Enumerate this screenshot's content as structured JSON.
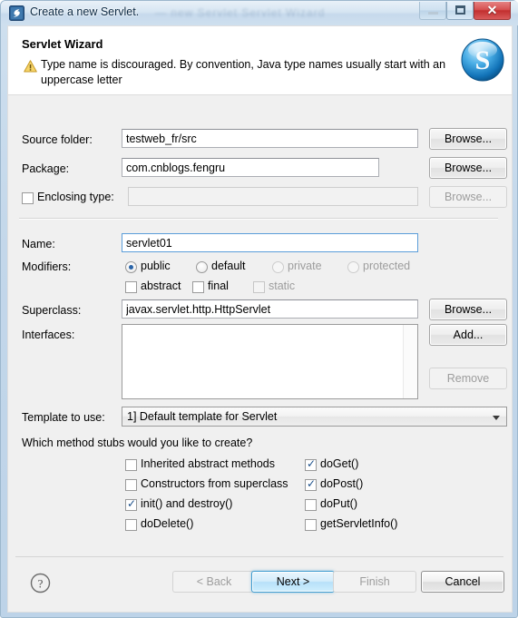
{
  "window": {
    "title": "Create a new Servlet.",
    "title_ghost": "— new Servlet   Servlet   Wizard",
    "icon": "eclipse-servlet-icon",
    "controls": {
      "minimize": "minimize-button",
      "maximize": "restore-button",
      "close": "close-button",
      "close_glyph": "✕"
    }
  },
  "banner": {
    "title": "Servlet Wizard",
    "message": "Type name is discouraged. By convention, Java type names usually start with an uppercase letter",
    "warning_icon": "warning-triangle-icon",
    "logo": "servlet-wizard-logo",
    "logo_letter": "S"
  },
  "fields": {
    "source_folder": {
      "label": "Source folder:",
      "value": "testweb_fr/src",
      "browse": "Browse..."
    },
    "package": {
      "label": "Package:",
      "value": "com.cnblogs.fengru",
      "browse": "Browse..."
    },
    "enclosing_type": {
      "label": "Enclosing type:",
      "value": "",
      "checked": false,
      "browse": "Browse...",
      "browse_enabled": false
    },
    "name": {
      "label": "Name:",
      "value": "servlet01"
    },
    "superclass": {
      "label": "Superclass:",
      "value": "javax.servlet.http.HttpServlet",
      "browse": "Browse..."
    },
    "interfaces": {
      "label": "Interfaces:",
      "items": [],
      "add": "Add...",
      "remove": "Remove",
      "remove_enabled": false
    },
    "template": {
      "label": "Template to use:",
      "selected": "1] Default template for Servlet",
      "options": [
        "1] Default template for Servlet"
      ]
    }
  },
  "modifiers": {
    "label": "Modifiers:",
    "access": [
      {
        "label": "public",
        "selected": true,
        "enabled": true
      },
      {
        "label": "default",
        "selected": false,
        "enabled": true
      },
      {
        "label": "private",
        "selected": false,
        "enabled": false
      },
      {
        "label": "protected",
        "selected": false,
        "enabled": false
      }
    ],
    "flags": [
      {
        "label": "abstract",
        "checked": false,
        "enabled": true
      },
      {
        "label": "final",
        "checked": false,
        "enabled": true
      },
      {
        "label": "static",
        "checked": false,
        "enabled": false
      }
    ]
  },
  "stubs": {
    "question": "Which method stubs would you like to create?",
    "left": [
      {
        "label": "Inherited abstract methods",
        "checked": false
      },
      {
        "label": "Constructors from superclass",
        "checked": false
      },
      {
        "label": "init() and destroy()",
        "checked": true
      },
      {
        "label": "doDelete()",
        "checked": false
      }
    ],
    "right": [
      {
        "label": "doGet()",
        "checked": true
      },
      {
        "label": "doPost()",
        "checked": true
      },
      {
        "label": "doPut()",
        "checked": false
      },
      {
        "label": "getServletInfo()",
        "checked": false
      }
    ],
    "check_glyph": "✓"
  },
  "footer": {
    "help_icon": "help-question-icon",
    "help_glyph": "?",
    "buttons": [
      {
        "label": "< Back",
        "enabled": false,
        "default": false
      },
      {
        "label": "Next >",
        "enabled": true,
        "default": true
      },
      {
        "label": "Finish",
        "enabled": false,
        "default": false
      },
      {
        "label": "Cancel",
        "enabled": true,
        "default": false
      }
    ]
  },
  "colors": {
    "window_frame": "#c3d7ea",
    "dialog_bg": "#f0f0f0",
    "banner_bg": "#ffffff",
    "close_red": "#c22f2f",
    "default_button_blue": "#3c9bd0",
    "warning_amber": "#f3c33c",
    "logo_blue": "#1f8fd6"
  }
}
